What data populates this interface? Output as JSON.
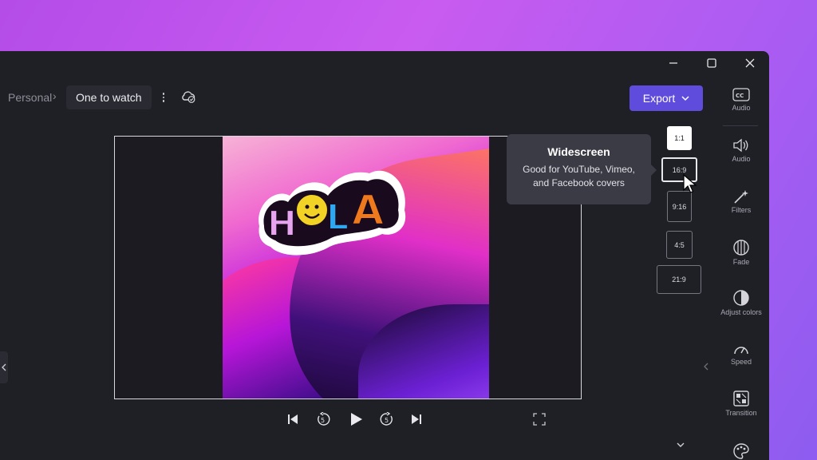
{
  "window": {
    "controls": [
      "minimize",
      "maximize",
      "close"
    ]
  },
  "breadcrumb": {
    "parent": "Personal",
    "separator": "›",
    "current": "One to watch"
  },
  "toolbar": {
    "export_label": "Export"
  },
  "preview": {
    "sticker_text": "HOLA"
  },
  "aspect_ratios": {
    "options": [
      "1:1",
      "16:9",
      "9:16",
      "4:5",
      "21:9"
    ],
    "selected": "1:1",
    "hovered": "16:9"
  },
  "tooltip": {
    "title": "Widescreen",
    "line1": "Good for YouTube, Vimeo,",
    "line2": "and Facebook covers"
  },
  "properties_panel": {
    "items": [
      {
        "label": "Audio",
        "icon": "captions-icon"
      },
      {
        "label": "Audio",
        "icon": "speaker-icon"
      },
      {
        "label": "Filters",
        "icon": "magic-wand-icon"
      },
      {
        "label": "Fade",
        "icon": "fade-icon"
      },
      {
        "label": "Adjust colors",
        "icon": "half-circle-icon"
      },
      {
        "label": "Speed",
        "icon": "speedometer-icon"
      },
      {
        "label": "Transition",
        "icon": "transition-icon"
      },
      {
        "label": "",
        "icon": "palette-icon"
      }
    ]
  },
  "playback": {
    "skip_back_seconds": "5",
    "skip_forward_seconds": "5"
  },
  "colors": {
    "accent": "#5f4bdc",
    "app_bg": "#1f1f26",
    "tooltip_bg": "#3b3b45"
  }
}
